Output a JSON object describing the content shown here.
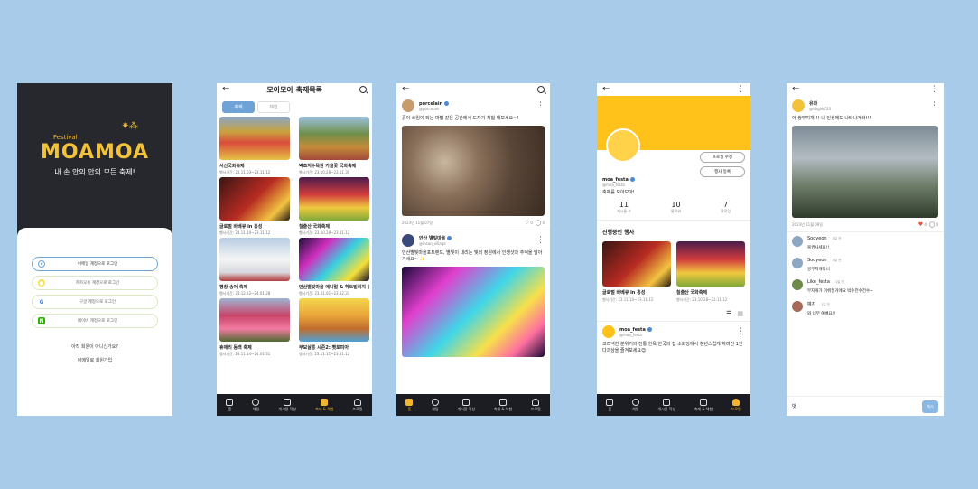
{
  "colors": {
    "background": "#a9cbea",
    "accent": "#f3b52e",
    "primary_blue": "#6fa3d6",
    "dark": "#27282d"
  },
  "nav": {
    "items": [
      "홈",
      "채팅",
      "게시물 작성",
      "축제 & 체험",
      "프로필"
    ]
  },
  "screen1": {
    "festival": "Festival",
    "logo": "MOAMOA",
    "tagline": "내 손 안의 안의 모든 축제!",
    "login_buttons": [
      {
        "label": "이메일 계정으로 로그인",
        "icon": "moamoa-icon"
      },
      {
        "label": "카카오톡 계정으로 로그인",
        "icon": "kakao-icon"
      },
      {
        "label": "구글 계정으로 로그인",
        "icon": "google-icon"
      },
      {
        "label": "네이버 계정으로 로그인",
        "icon": "naver-icon"
      }
    ],
    "signup_question": "아직 회원이 아니신가요?",
    "signup": "이메일로 회원가입"
  },
  "screen2": {
    "title": "모아모아 축제목록",
    "tabs": [
      "축제",
      "체험"
    ],
    "festivals": [
      {
        "name": "서산국화축제",
        "date": "행사기간: 23.11.03~23.11.12"
      },
      {
        "name": "벽초지수목원 가을꽃 국화축제",
        "date": "행사기간: 23.10.28~23.11.30"
      },
      {
        "name": "글로벌 바베큐 in 홍성",
        "date": "행사기간: 23.11.10~23.11.12"
      },
      {
        "name": "칠출산 국화축제",
        "date": "행사기간: 23.10.28~23.11.12"
      },
      {
        "name": "평창 송어 축제",
        "date": "행사기간: 23.12.22~24.01.28"
      },
      {
        "name": "안산별빛마을 에니멀 & 하트빌리지 빛축제",
        "date": "행사기간: 23.01.01~23.12.31"
      },
      {
        "name": "휴애리 동백 축제",
        "date": "행사기간: 23.11.14~24.01.31"
      },
      {
        "name": "무보살롱 시즌2: 펫토피아",
        "date": "행사기간: 23.11.11~23.11.12"
      }
    ]
  },
  "screen3": {
    "posts": [
      {
        "user": "porcelain",
        "handle": "@porcelain",
        "text": "흙이 쓰임이 되는 마법 같은 공간에서 도자기 체험 해보세요~!",
        "date": "2023년 11월 07일",
        "likes": "0",
        "comments": "0"
      },
      {
        "user": "안산 별빛마을",
        "handle": "@insan_village",
        "text": "안산별빛마을포토랜드, 별빛이 내리는 빛의 정원에서 인생샷과 추억을 담아가세요~ ✨",
        "date": "",
        "likes": "",
        "comments": ""
      }
    ]
  },
  "screen4": {
    "username": "moa_festa",
    "handle": "@moa_festa",
    "bio": "축제를 모아모아!",
    "edit_profile": "프로필 수정",
    "register_event": "행사 등록",
    "stats": [
      {
        "value": "11",
        "label": "게시물 수"
      },
      {
        "value": "10",
        "label": "팔로워"
      },
      {
        "value": "7",
        "label": "팔로잉"
      }
    ],
    "section_title": "진행중인 행사",
    "events": [
      {
        "name": "글로벌 바베큐 in 홍성",
        "date": "행사기간: 23.11.10~23.11.12"
      },
      {
        "name": "칠출산 국화축제",
        "date": "행사기간: 23.10.28~23.11.12"
      }
    ],
    "post": {
      "user": "moa_festa",
      "handle": "@moa_festa",
      "text": "고즈넉한 분위기의 전통 한옥 한국의 집 소화당에서 청년스럽게 차려진 1인 다과상을 즐겨보세요😊"
    }
  },
  "screen5": {
    "post": {
      "user": "유화",
      "handle": "@dbghk723",
      "text": "아 쌍무지개!!! 내 인생에도 나타나거라!!!",
      "date": "2023년 11월 08일",
      "likes": "4",
      "comments": "4"
    },
    "comments": [
      {
        "user": "Sooyeon",
        "ago": "1일 전",
        "text": "복권사세요!!"
      },
      {
        "user": "Sooyeon",
        "ago": "1일 전",
        "text": "쌍무지개라니"
      },
      {
        "user": "Like_festa",
        "ago": "1일 전",
        "text": "무지개가 이뤄질거에요 박수전수전수~"
      },
      {
        "user": "예지",
        "ago": "1일 전",
        "text": "와 너무 예뻐요!!"
      }
    ],
    "input_placeholder": "댓",
    "send": "게시"
  }
}
